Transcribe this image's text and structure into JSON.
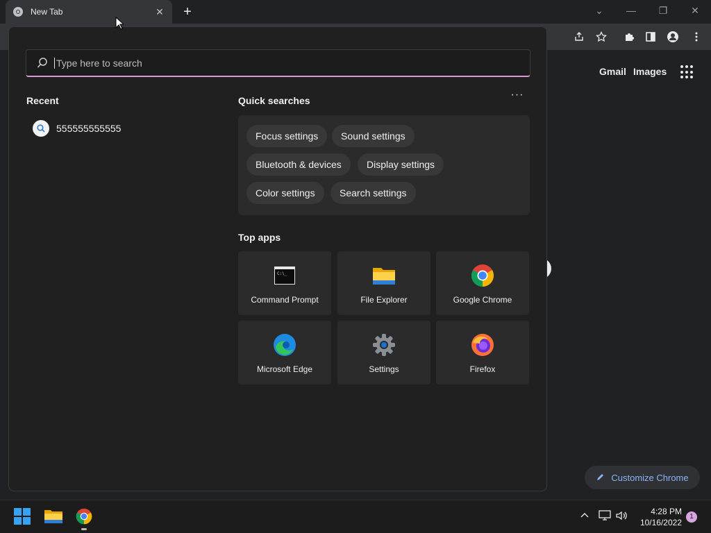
{
  "browser": {
    "tab_title": "New Tab",
    "tab_close": "✕",
    "new_tab": "+"
  },
  "ntp": {
    "gmail": "Gmail",
    "images": "Images",
    "customize": "Customize Chrome"
  },
  "flyout": {
    "search_placeholder": "Type here to search",
    "recent_heading": "Recent",
    "recent_items": [
      "555555555555"
    ],
    "quick_heading": "Quick searches",
    "more": "···",
    "quick_searches": [
      "Focus settings",
      "Sound settings",
      "Bluetooth & devices",
      "Display settings",
      "Color settings",
      "Search settings"
    ],
    "top_apps_heading": "Top apps",
    "top_apps": [
      {
        "name": "Command Prompt",
        "icon": "command-prompt-icon"
      },
      {
        "name": "File Explorer",
        "icon": "file-explorer-icon"
      },
      {
        "name": "Google Chrome",
        "icon": "chrome-icon"
      },
      {
        "name": "Microsoft Edge",
        "icon": "edge-icon"
      },
      {
        "name": "Settings",
        "icon": "settings-gear-icon"
      },
      {
        "name": "Firefox",
        "icon": "firefox-icon"
      }
    ]
  },
  "taskbar": {
    "time": "4:28 PM",
    "date": "10/16/2022",
    "notification_count": "1"
  },
  "colors": {
    "accent": "#d39ad8",
    "link": "#8ab4f8"
  }
}
